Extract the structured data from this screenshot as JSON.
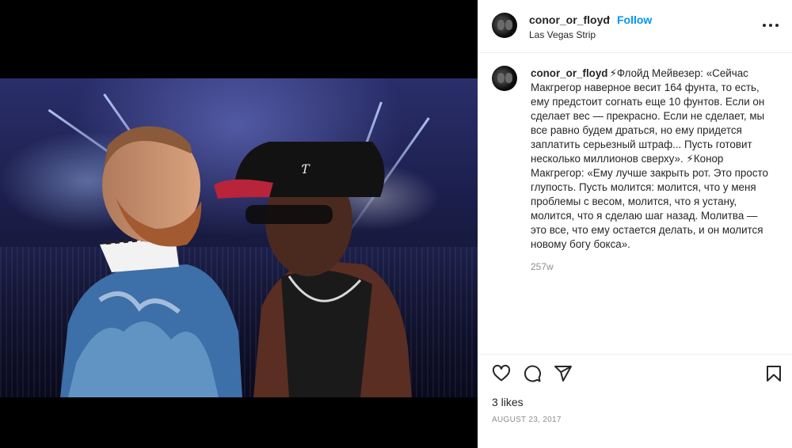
{
  "post": {
    "username": "conor_or_floyd",
    "dot": "•",
    "follow_label": "Follow",
    "location": "Las Vegas Strip",
    "caption_text": "⚡Флойд Мейвезер: «Сейчас Макгрегор наверное весит 164 фунта, то есть, ему предстоит согнать еще 10 фунтов. Если он сделает вес — прекрасно. Если не сделает, мы все равно будем драться, но ему придется заплатить серьезный штраф... Пусть готовит несколько миллионов сверху». ⚡Конор Макгрегор: «Ему лучше закрыть рот. Это просто глупость. Пусть молится: молится, что у меня проблемы с весом, молится, что я устану, молится, что я сделаю шаг назад. Молитва — это все, что ему остается делать, и он молится новому богу бокса».",
    "caption_age": "257w",
    "likes": "3 likes",
    "date": "AUGUST 23, 2017"
  },
  "icons": {
    "more": "more-options-icon",
    "like": "heart-icon",
    "comment": "comment-icon",
    "share": "paper-plane-icon",
    "save": "bookmark-icon"
  },
  "colors": {
    "accent": "#0095f6",
    "text": "#262626",
    "muted": "#8e8e8e"
  }
}
